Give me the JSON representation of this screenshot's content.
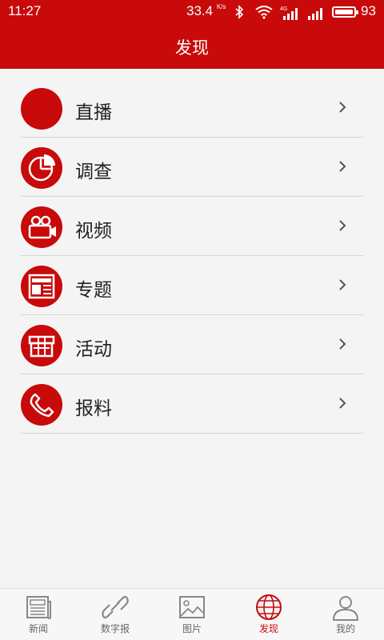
{
  "status_bar": {
    "time": "11:27",
    "speed_value": "33.4",
    "speed_unit": "K/s",
    "network": "4G",
    "battery": "93"
  },
  "header": {
    "title": "发现"
  },
  "menu": [
    {
      "label": "直播",
      "icon": "live-icon"
    },
    {
      "label": "调查",
      "icon": "survey-pie-icon"
    },
    {
      "label": "视频",
      "icon": "video-camera-icon"
    },
    {
      "label": "专题",
      "icon": "newspaper-topic-icon"
    },
    {
      "label": "活动",
      "icon": "gift-icon"
    },
    {
      "label": "报料",
      "icon": "phone-icon"
    }
  ],
  "tabs": [
    {
      "label": "新闻",
      "icon": "news-icon",
      "active": false
    },
    {
      "label": "数字报",
      "icon": "link-icon",
      "active": false
    },
    {
      "label": "图片",
      "icon": "image-icon",
      "active": false
    },
    {
      "label": "发现",
      "icon": "globe-icon",
      "active": true
    },
    {
      "label": "我的",
      "icon": "user-icon",
      "active": false
    }
  ],
  "colors": {
    "accent": "#c80a0a",
    "background": "#f4f4f4"
  }
}
